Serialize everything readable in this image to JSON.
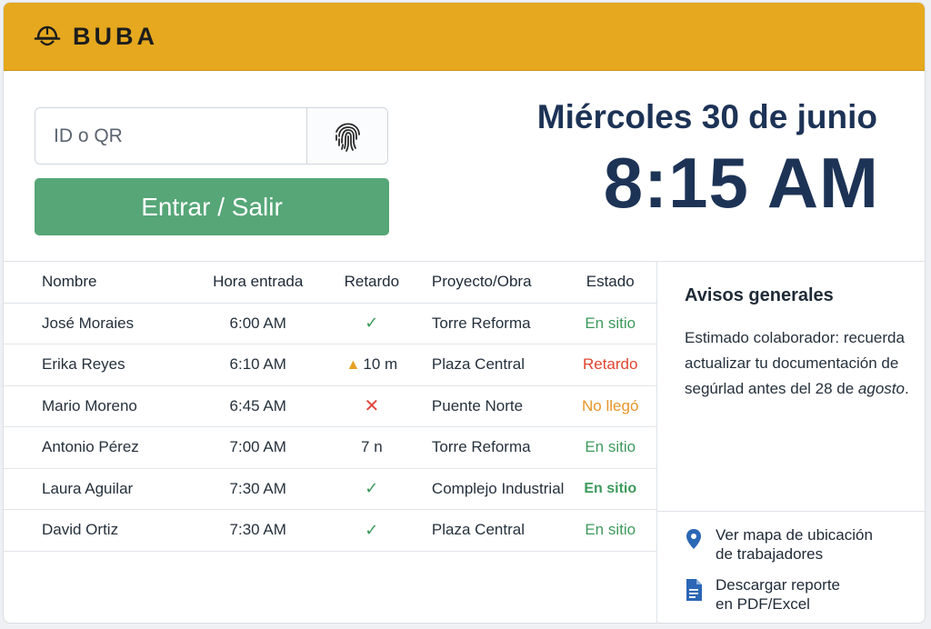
{
  "brand": {
    "name": "BUBA",
    "accent": "#e5a81e",
    "icon": "helmet-icon"
  },
  "checkin": {
    "input_placeholder": "ID o QR",
    "input_value": "",
    "fingerprint_icon": "fingerprint-icon",
    "enter_button_label": "Entrar / Salir",
    "enter_button_color": "#56a677"
  },
  "clock": {
    "date": "Miércoles 30 de junio",
    "time": "8:15 AM"
  },
  "table": {
    "headers": [
      "Nombre",
      "Hora entrada",
      "Retardo",
      "Proyecto/Obra",
      "Estado"
    ],
    "rows": [
      {
        "name": "José Moraies",
        "time": "6:00 AM",
        "delay": "",
        "delay_icon": "check-icon",
        "project": "Torre Reforma",
        "status": "En sitio",
        "status_color": "#3d9a5c"
      },
      {
        "name": "Erika Reyes",
        "time": "6:10 AM",
        "delay": "10 m",
        "delay_icon": "warning-icon",
        "project": "Plaza Central",
        "status": "Retardo",
        "status_color": "#e0452f"
      },
      {
        "name": "Mario Moreno",
        "time": "6:45 AM",
        "delay": "",
        "delay_icon": "x-icon",
        "project": "Puente Norte",
        "status": "No llegó",
        "status_color": "#e6962a"
      },
      {
        "name": "Antonio Pérez",
        "time": "7:00 AM",
        "delay": "7 n",
        "delay_icon": "",
        "project": "Torre Reforma",
        "status": "En sitio",
        "status_color": "#3d9a5c"
      },
      {
        "name": "Laura Aguilar",
        "time": "7:30 AM",
        "delay": "",
        "delay_icon": "check-icon",
        "project": "Complejo Industrial",
        "status": "En sitio",
        "status_color": "#3d9a5c"
      },
      {
        "name": "David Ortiz",
        "time": "7:30 AM",
        "delay": "",
        "delay_icon": "check-icon",
        "project": "Plaza Central",
        "status": "En sitio",
        "status_color": "#3d9a5c"
      }
    ]
  },
  "notices": {
    "title": "Avisos generales",
    "body_before": "Estimado colaborador: recuerda actualizar tu documentación de segúrlad antes del 28 de ",
    "body_emphasis": "agosto",
    "body_after": "."
  },
  "links": [
    {
      "label_line1": "Ver mapa de ubicación",
      "label_line2": "de trabajadores",
      "icon": "map-pin-icon"
    },
    {
      "label_line1": "Descargar reporte",
      "label_line2": "en PDF/Excel",
      "icon": "document-icon"
    }
  ]
}
